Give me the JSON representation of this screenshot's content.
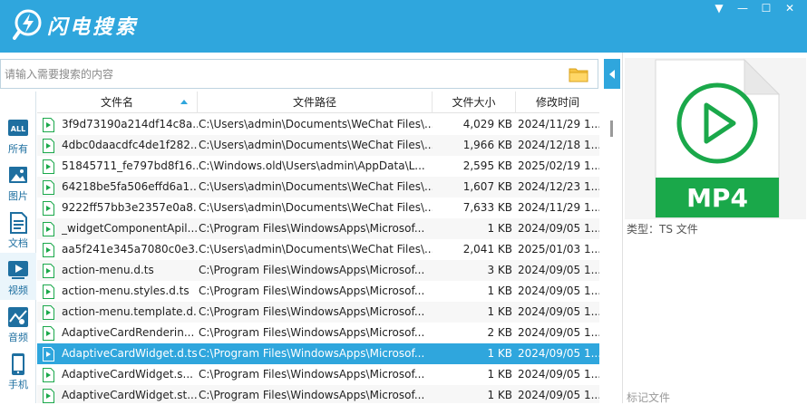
{
  "app": {
    "title": "闪电搜索"
  },
  "window_controls": [
    "▼",
    "—",
    "☐",
    "✕"
  ],
  "search": {
    "placeholder": "请输入需要搜索的内容"
  },
  "sidebar": {
    "items": [
      {
        "label": "所有",
        "icon": "all-icon"
      },
      {
        "label": "图片",
        "icon": "image-icon"
      },
      {
        "label": "文档",
        "icon": "document-icon"
      },
      {
        "label": "视频",
        "icon": "video-icon",
        "active": true
      },
      {
        "label": "音频",
        "icon": "audio-icon"
      },
      {
        "label": "手机",
        "icon": "phone-icon"
      }
    ]
  },
  "table": {
    "columns": [
      "文件名",
      "文件路径",
      "文件大小",
      "修改时间"
    ],
    "rows": [
      {
        "name": "3f9d73190a214df14c8a...",
        "path": "C:\\Users\\admin\\Documents\\WeChat Files\\...",
        "size": "4,029 KB",
        "time": "2024/11/29 1..."
      },
      {
        "name": "4dbc0daacdfc4de1f282...",
        "path": "C:\\Users\\admin\\Documents\\WeChat Files\\...",
        "size": "1,966 KB",
        "time": "2024/12/18 1..."
      },
      {
        "name": "51845711_fe797bd8f16...",
        "path": "C:\\Windows.old\\Users\\admin\\AppData\\L...",
        "size": "2,595 KB",
        "time": "2025/02/19 1..."
      },
      {
        "name": "64218be5fa506effd6a1...",
        "path": "C:\\Users\\admin\\Documents\\WeChat Files\\...",
        "size": "1,607 KB",
        "time": "2024/12/23 1..."
      },
      {
        "name": "9222ff57bb3e2357e0a8...",
        "path": "C:\\Users\\admin\\Documents\\WeChat Files\\...",
        "size": "7,633 KB",
        "time": "2024/11/29 1..."
      },
      {
        "name": "_widgetComponentApil...",
        "path": "C:\\Program Files\\WindowsApps\\Microsof...",
        "size": "1 KB",
        "time": "2024/09/05 1..."
      },
      {
        "name": "aa5f241e345a7080c0e3...",
        "path": "C:\\Users\\admin\\Documents\\WeChat Files\\...",
        "size": "2,041 KB",
        "time": "2025/01/03 1..."
      },
      {
        "name": "action-menu.d.ts",
        "path": "C:\\Program Files\\WindowsApps\\Microsof...",
        "size": "3 KB",
        "time": "2024/09/05 1..."
      },
      {
        "name": "action-menu.styles.d.ts",
        "path": "C:\\Program Files\\WindowsApps\\Microsof...",
        "size": "1 KB",
        "time": "2024/09/05 1..."
      },
      {
        "name": "action-menu.template.d...",
        "path": "C:\\Program Files\\WindowsApps\\Microsof...",
        "size": "1 KB",
        "time": "2024/09/05 1..."
      },
      {
        "name": "AdaptiveCardRenderin...",
        "path": "C:\\Program Files\\WindowsApps\\Microsof...",
        "size": "2 KB",
        "time": "2024/09/05 1..."
      },
      {
        "name": "AdaptiveCardWidget.d.ts",
        "path": "C:\\Program Files\\WindowsApps\\Microsof...",
        "size": "1 KB",
        "time": "2024/09/05 1...",
        "selected": true
      },
      {
        "name": "AdaptiveCardWidget.s...",
        "path": "C:\\Program Files\\WindowsApps\\Microsof...",
        "size": "1 KB",
        "time": "2024/09/05 1..."
      },
      {
        "name": "AdaptiveCardWidget.st...",
        "path": "C:\\Program Files\\WindowsApps\\Microsof...",
        "size": "1 KB",
        "time": "2024/09/05 1..."
      }
    ]
  },
  "preview": {
    "badge": "MP4",
    "type_label": "类型：TS 文件",
    "tag_label": "标记文件"
  },
  "colors": {
    "accent": "#2fa6dd",
    "file_green": "#1aa84a"
  }
}
